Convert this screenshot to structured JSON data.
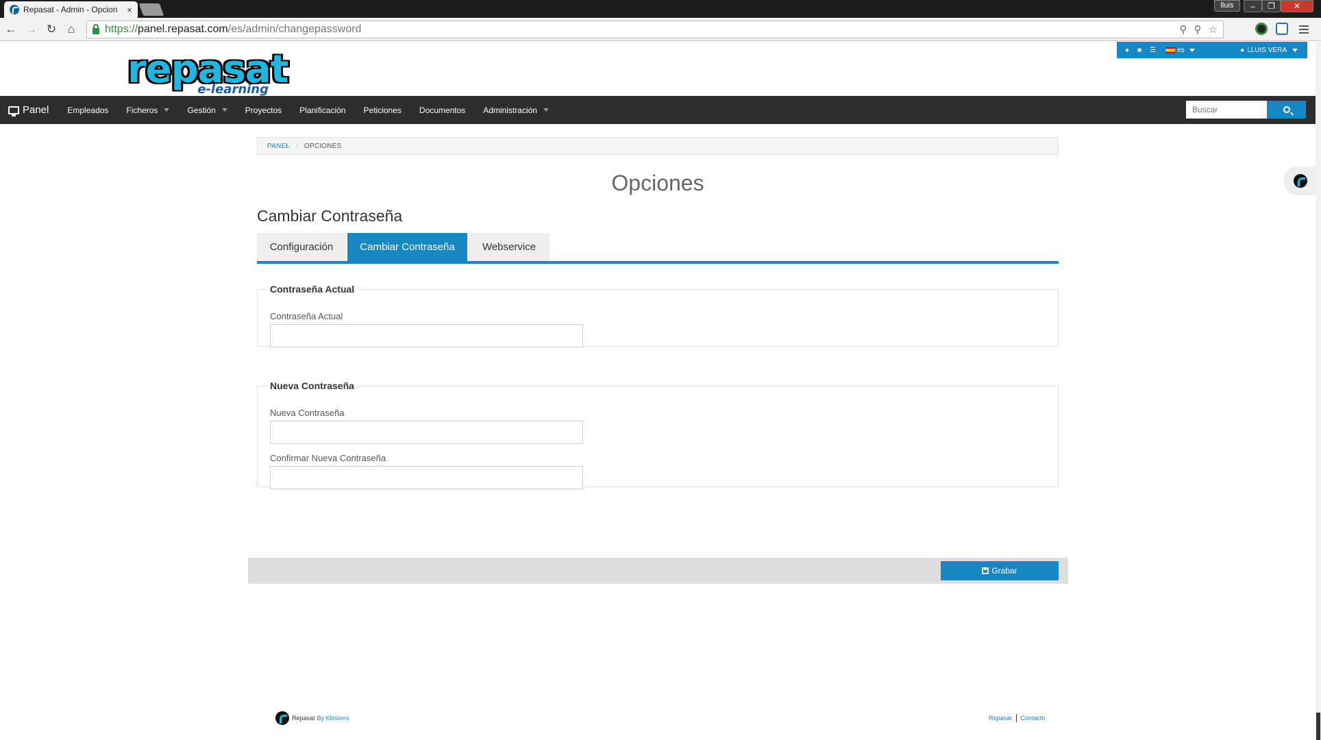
{
  "browser": {
    "tab_title": "Repasat - Admin - Opcion",
    "tab_close": "×",
    "window_user": "lluis",
    "url_scheme": "https://",
    "url_host": "panel.repasat.com",
    "url_path": "/es/admin/changepassword"
  },
  "utility_bar": {
    "language": "es",
    "user_name": "LLUIS VERA"
  },
  "logo": {
    "main": "repasat",
    "sub": "e-learning"
  },
  "nav": {
    "brand": "Panel",
    "items": [
      {
        "label": "Empleados",
        "dropdown": false
      },
      {
        "label": "Ficheros",
        "dropdown": true
      },
      {
        "label": "Gestión",
        "dropdown": true
      },
      {
        "label": "Proyectos",
        "dropdown": false
      },
      {
        "label": "Planificación",
        "dropdown": false
      },
      {
        "label": "Peticiones",
        "dropdown": false
      },
      {
        "label": "Documentos",
        "dropdown": false
      },
      {
        "label": "Administración",
        "dropdown": true
      }
    ],
    "search_placeholder": "Buscar"
  },
  "breadcrumb": {
    "home": "PANEL",
    "separator": "/",
    "current": "OPCIONES"
  },
  "page_title": "Opciones",
  "section_title": "Cambiar Contraseña",
  "tabs": [
    {
      "label": "Configuración",
      "active": false
    },
    {
      "label": "Cambiar Contraseña",
      "active": true
    },
    {
      "label": "Webservice",
      "active": false
    }
  ],
  "fieldsets": {
    "current": {
      "legend": "Contraseña Actual",
      "field_label": "Contraseña Actual",
      "value": ""
    },
    "new": {
      "legend": "Nueva Contraseña",
      "new_label": "Nueva Contraseña",
      "confirm_label": "Confirmar Nueva Contraseña",
      "new_value": "",
      "confirm_value": ""
    }
  },
  "actions": {
    "save_label": "Grabar"
  },
  "footer": {
    "brand": "Repasat",
    "by": "By Klosions",
    "links": [
      "Repasat",
      "Contacto"
    ]
  },
  "colors": {
    "accent": "#1687c2",
    "nav_bg": "#2d2d2d",
    "logo_cyan": "#1fb6e0"
  }
}
